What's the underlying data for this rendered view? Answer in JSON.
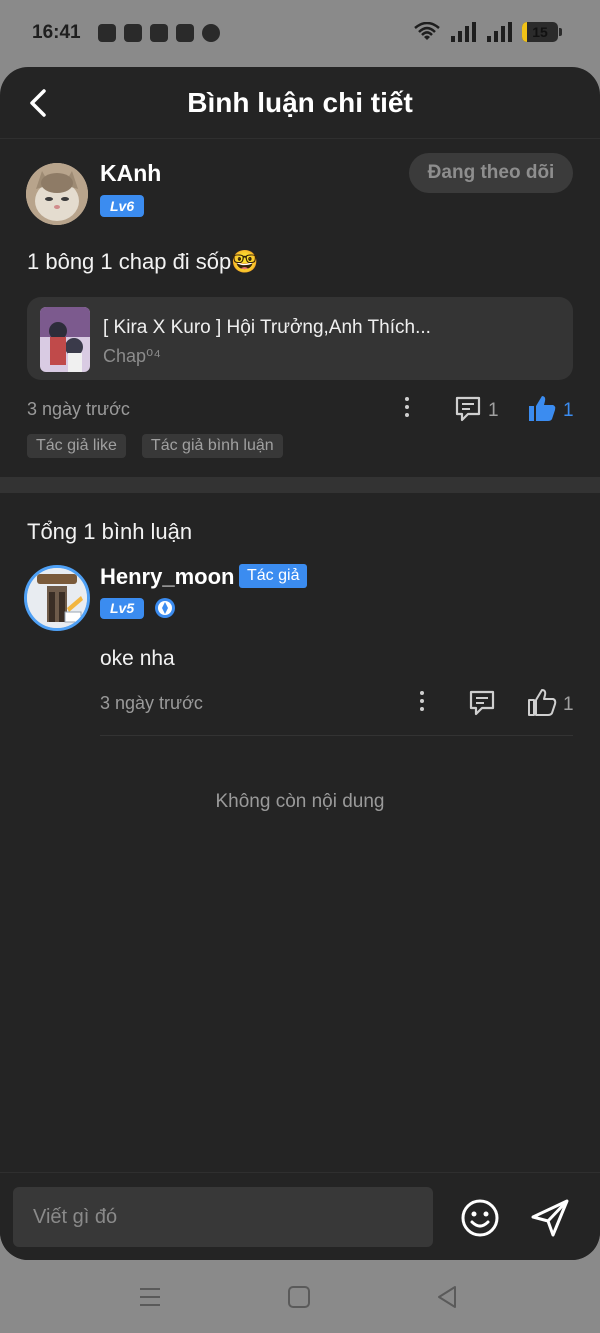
{
  "status_bar": {
    "time": "16:41",
    "app_icons": [
      "shopee-icon",
      "youtube-icon",
      "tiktok-icon",
      "discord-icon",
      "facebook-icon"
    ],
    "battery": "15",
    "battery_level": 0.15,
    "battery_color": "#f2c318"
  },
  "header": {
    "title": "Bình luận chi tiết"
  },
  "post": {
    "author": "KAnh",
    "level": "Lv6",
    "follow_label": "Đang theo dõi",
    "text": "1 bông 1 chap đi sốp🤓",
    "chap_title": "[ Kira X Kuro ] Hội Trưởng,Anh Thích...",
    "chap_sub": "Chap⁰⁴",
    "time": "3 ngày trước",
    "comment_count": "1",
    "like_count": "1",
    "liked": true,
    "tags": [
      "Tác giả like",
      "Tác giả bình luận"
    ]
  },
  "comments": {
    "total_label": "Tổng 1 bình luận",
    "items": [
      {
        "author": "Henry_moon",
        "badge": "Tác giả",
        "level": "Lv5",
        "text": "oke nha",
        "time": "3 ngày trước",
        "like_count": "1"
      }
    ],
    "end_label": "Không còn nội dung"
  },
  "composer": {
    "placeholder": "Viết gì đó"
  },
  "colors": {
    "accent": "#3b8cf0",
    "background": "#242424",
    "card": "#343434"
  }
}
